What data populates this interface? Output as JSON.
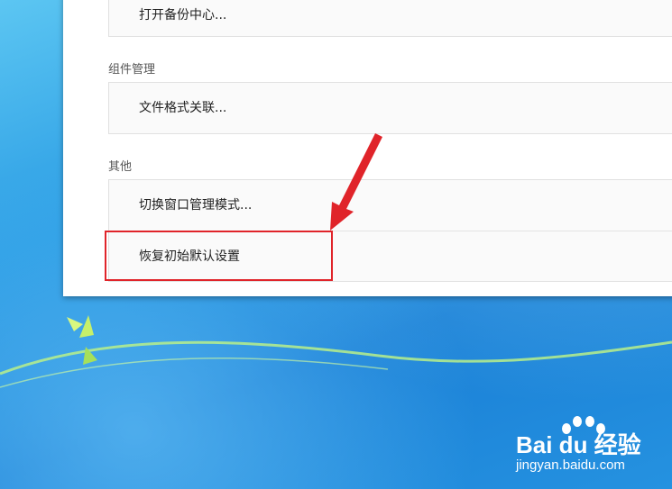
{
  "dialog": {
    "sections": [
      {
        "label": "",
        "items": [
          "打开备份中心..."
        ]
      },
      {
        "label": "组件管理",
        "items": [
          "文件格式关联..."
        ]
      },
      {
        "label": "其他",
        "items": [
          "切换窗口管理模式...",
          "恢复初始默认设置"
        ]
      }
    ]
  },
  "annotation": {
    "highlight_color": "#e0242a",
    "highlighted_item": "恢复初始默认设置"
  },
  "watermark": {
    "brand": "Bai du 经验",
    "url": "jingyan.baidu.com"
  },
  "colors": {
    "panel_bg": "#ffffff",
    "row_bg": "#fafafa",
    "arrow": "#e0242a",
    "desktop": "#2a9ce4"
  }
}
